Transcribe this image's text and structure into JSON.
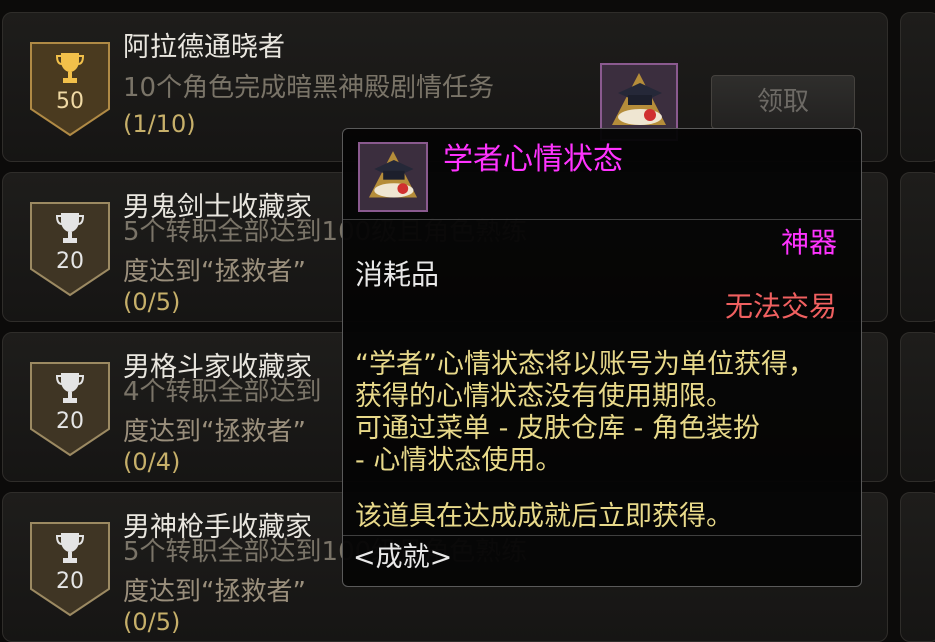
{
  "achievements": [
    {
      "title": "阿拉德通晓者",
      "desc": "10个角色完成暗黑神殿剧情任务",
      "desc2": "",
      "progress": "(1/10)",
      "points": "50",
      "badge": "gold"
    },
    {
      "title": "男鬼剑士收藏家",
      "desc": "5个转职全部达到100级且角色熟练",
      "desc2": "度达到“拯救者”",
      "progress": "(0/5)",
      "points": "20",
      "badge": "silver"
    },
    {
      "title": "男格斗家收藏家",
      "desc": "4个转职全部达到",
      "desc2": "度达到“拯救者”",
      "progress": "(0/4)",
      "points": "20",
      "badge": "silver"
    },
    {
      "title": "男神枪手收藏家",
      "desc": "5个转职全部达到100级且角色熟练",
      "desc2": "度达到“拯救者”",
      "progress": "(0/5)",
      "points": "20",
      "badge": "silver"
    }
  ],
  "claim_label": "领取",
  "tooltip": {
    "name": "学者心情状态",
    "rarity": "神器",
    "type": "消耗品",
    "trade": "无法交易",
    "lines": [
      "“学者”心情状态将以账号为单位获得，",
      "获得的心情状态没有使用期限。",
      "可通过菜单 - 皮肤仓库 - 角色装扮",
      "- 心情状态使用。",
      "",
      "该道具在达成成就后立即获得。"
    ],
    "source": "<成就>"
  },
  "colors": {
    "epic_magenta": "#ff33ff",
    "untradeable_red": "#f06060",
    "desc_yellow": "#e8d98a"
  }
}
